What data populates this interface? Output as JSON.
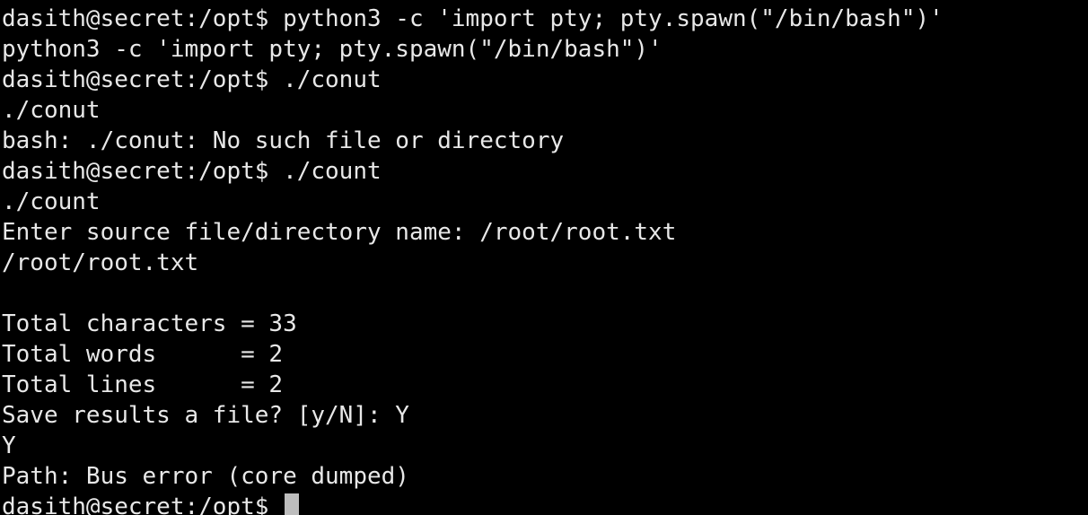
{
  "terminal": {
    "background": "#000000",
    "foreground": "#e8e8e8",
    "cursor_color": "#bdbdbd",
    "lines": [
      "dasith@secret:/opt$ python3 -c 'import pty; pty.spawn(\"/bin/bash\")'",
      "python3 -c 'import pty; pty.spawn(\"/bin/bash\")'",
      "dasith@secret:/opt$ ./conut",
      "./conut",
      "bash: ./conut: No such file or directory",
      "dasith@secret:/opt$ ./count",
      "./count",
      "Enter source file/directory name: /root/root.txt",
      "/root/root.txt",
      "",
      "Total characters = 33",
      "Total words      = 2",
      "Total lines      = 2",
      "Save results a file? [y/N]: Y",
      "Y",
      "Path: Bus error (core dumped)"
    ],
    "prompt": "dasith@secret:/opt$ "
  }
}
